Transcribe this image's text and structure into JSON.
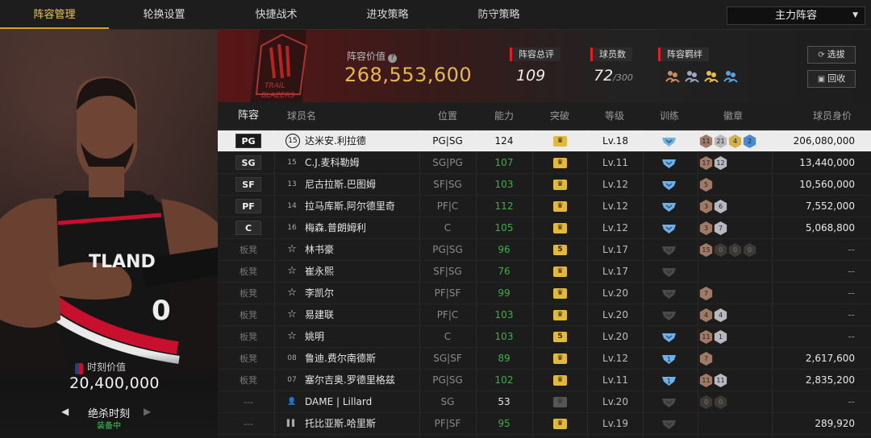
{
  "tabs": [
    {
      "label": "阵容管理",
      "active": true
    },
    {
      "label": "轮换设置",
      "active": false
    },
    {
      "label": "快捷战术",
      "active": false
    },
    {
      "label": "进攻策略",
      "active": false
    },
    {
      "label": "防守策略",
      "active": false
    }
  ],
  "lineup_select": {
    "value": "主力阵容"
  },
  "header": {
    "value_label": "阵容价值",
    "value": "268,553,600",
    "overall_label": "阵容总评",
    "overall": "109",
    "players_label": "球员数",
    "players_count": "72",
    "players_max": "/300",
    "bond_label": "阵容羁绊",
    "btn_scout": "选拔",
    "btn_recycle": "回收"
  },
  "moment": {
    "label": "时刻价值",
    "value": "20,400,000",
    "skill_name": "绝杀时刻",
    "skill_status": "装备中"
  },
  "columns": [
    "阵容",
    "球员名",
    "位置",
    "能力",
    "突破",
    "等级",
    "训练",
    "徽章",
    "球员身价"
  ],
  "rows": [
    {
      "slot": "PG",
      "slot_type": "starter",
      "num": "15",
      "name": "达米安.利拉德",
      "pos": "PG|SG",
      "ability": "124",
      "breakthrough": "crown",
      "level": "Lv.18",
      "train": "blue",
      "badges": [
        [
          "11",
          "b-bronze"
        ],
        [
          "21",
          "b-silver"
        ],
        [
          "4",
          "b-gold"
        ],
        [
          "2",
          "b-blue"
        ]
      ],
      "price": "206,080,000",
      "selected": true
    },
    {
      "slot": "SG",
      "slot_type": "starter",
      "num": "15",
      "name": "C.J.麦科勒姆",
      "pos": "SG|PG",
      "ability": "107",
      "breakthrough": "crown",
      "level": "Lv.11",
      "train": "blue",
      "badges": [
        [
          "17",
          "b-bronze"
        ],
        [
          "12",
          "b-silver"
        ]
      ],
      "price": "13,440,000"
    },
    {
      "slot": "SF",
      "slot_type": "starter",
      "num": "13",
      "name": "尼古拉斯.巴图姆",
      "pos": "SF|SG",
      "ability": "103",
      "breakthrough": "crown",
      "level": "Lv.12",
      "train": "blue",
      "badges": [
        [
          "5",
          "b-bronze"
        ]
      ],
      "price": "10,560,000"
    },
    {
      "slot": "PF",
      "slot_type": "starter",
      "num": "14",
      "name": "拉马库斯.阿尔德里奇",
      "pos": "PF|C",
      "ability": "112",
      "breakthrough": "crown",
      "level": "Lv.12",
      "train": "blue",
      "badges": [
        [
          "3",
          "b-bronze"
        ],
        [
          "6",
          "b-silver"
        ]
      ],
      "price": "7,552,000"
    },
    {
      "slot": "C",
      "slot_type": "starter",
      "num": "16",
      "name": "梅森.普朗姆利",
      "pos": "C",
      "ability": "105",
      "breakthrough": "crown",
      "level": "Lv.12",
      "train": "blue",
      "badges": [
        [
          "3",
          "b-bronze"
        ],
        [
          "7",
          "b-silver"
        ]
      ],
      "price": "5,068,800"
    },
    {
      "slot": "板凳",
      "slot_type": "bench",
      "num": "☆",
      "name": "林书豪",
      "pos": "PG|SG",
      "ability": "96",
      "breakthrough": "5",
      "level": "Lv.17",
      "train": "dark",
      "badges": [
        [
          "15",
          "b-bronze"
        ],
        [
          "0",
          "b-empty"
        ],
        [
          "0",
          "b-empty"
        ],
        [
          "0",
          "b-empty"
        ]
      ],
      "price": "--"
    },
    {
      "slot": "板凳",
      "slot_type": "bench",
      "num": "☆",
      "name": "崔永熙",
      "pos": "SF|SG",
      "ability": "76",
      "breakthrough": "crown",
      "level": "Lv.17",
      "train": "dark",
      "badges": [],
      "price": "--"
    },
    {
      "slot": "板凳",
      "slot_type": "bench",
      "num": "☆",
      "name": "李凯尔",
      "pos": "PF|SF",
      "ability": "99",
      "breakthrough": "crown",
      "level": "Lv.20",
      "train": "dark",
      "badges": [
        [
          "7",
          "b-bronze"
        ]
      ],
      "price": "--"
    },
    {
      "slot": "板凳",
      "slot_type": "bench",
      "num": "☆",
      "name": "易建联",
      "pos": "PF|C",
      "ability": "103",
      "breakthrough": "crown",
      "level": "Lv.20",
      "train": "dark",
      "badges": [
        [
          "4",
          "b-bronze"
        ],
        [
          "4",
          "b-silver"
        ]
      ],
      "price": "--"
    },
    {
      "slot": "板凳",
      "slot_type": "bench",
      "num": "☆",
      "name": "姚明",
      "pos": "C",
      "ability": "103",
      "breakthrough": "5",
      "level": "Lv.20",
      "train": "blue",
      "badges": [
        [
          "11",
          "b-bronze"
        ],
        [
          "1",
          "b-silver"
        ]
      ],
      "price": "--"
    },
    {
      "slot": "板凳",
      "slot_type": "bench",
      "num": "08",
      "name": "鲁迪.费尔南德斯",
      "pos": "SG|SF",
      "ability": "89",
      "breakthrough": "crown",
      "level": "Lv.12",
      "train": "blue1",
      "badges": [
        [
          "7",
          "b-bronze"
        ]
      ],
      "price": "2,617,600"
    },
    {
      "slot": "板凳",
      "slot_type": "bench",
      "num": "07",
      "name": "塞尔吉奥.罗德里格兹",
      "pos": "PG|SG",
      "ability": "102",
      "breakthrough": "crown",
      "level": "Lv.11",
      "train": "blue1",
      "badges": [
        [
          "11",
          "b-bronze"
        ],
        [
          "11",
          "b-silver"
        ]
      ],
      "price": "2,835,200"
    },
    {
      "slot": "---",
      "slot_type": "none",
      "num": "person",
      "name": "DAME | Lillard",
      "pos": "SG",
      "ability": "53",
      "breakthrough": "dim",
      "level": "Lv.20",
      "train": "dark",
      "badges": [
        [
          "0",
          "b-empty"
        ],
        [
          "0",
          "b-empty"
        ]
      ],
      "price": "--",
      "ability_white": true
    },
    {
      "slot": "---",
      "slot_type": "none",
      "num": "bars",
      "name": "托比亚斯.哈里斯",
      "pos": "PF|SF",
      "ability": "95",
      "breakthrough": "crown",
      "level": "Lv.19",
      "train": "dark",
      "badges": [],
      "price": "289,920"
    }
  ],
  "colors": {
    "accent": "#e8b84a",
    "tab_active": "#f2c94c",
    "ability_green": "#3fae4a",
    "brand_red": "#c8102e"
  }
}
